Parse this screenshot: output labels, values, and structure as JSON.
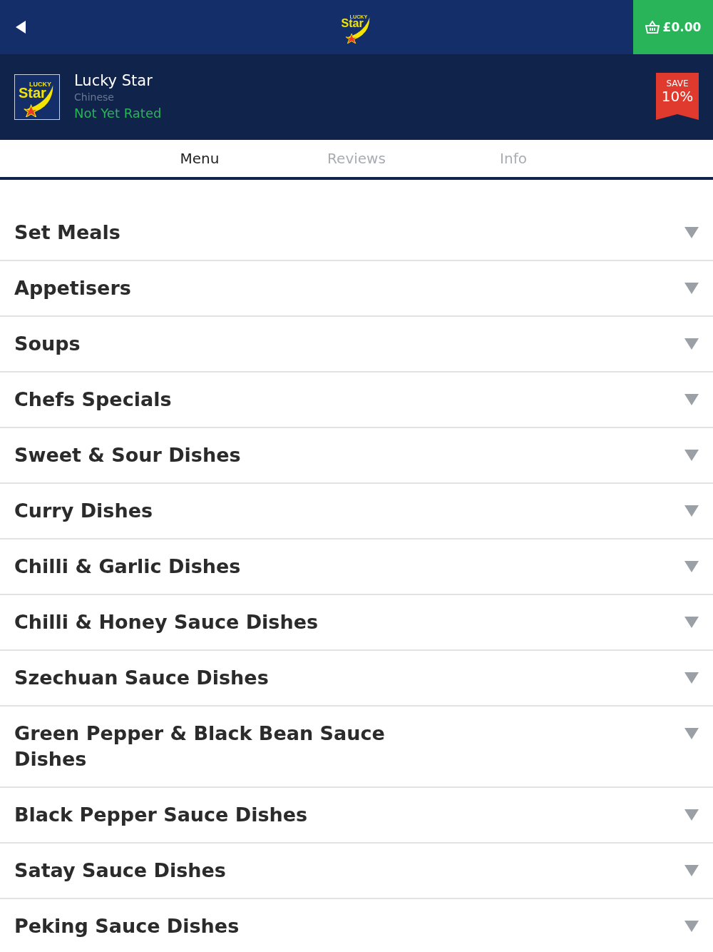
{
  "top_bar": {
    "logo": {
      "small": "LUCKY",
      "big": "Star"
    },
    "cart_total": "£0.00"
  },
  "restaurant": {
    "logo": {
      "small": "LUCKY",
      "big": "Star"
    },
    "name": "Lucky Star",
    "cuisine": "Chinese",
    "rating": "Not Yet Rated",
    "offer": {
      "label": "SAVE",
      "value": "10%"
    }
  },
  "tabs": [
    {
      "label": "Menu",
      "selected": true
    },
    {
      "label": "Reviews",
      "selected": false
    },
    {
      "label": "Info",
      "selected": false
    }
  ],
  "categories": [
    {
      "name": "Set Meals",
      "expanded": false
    },
    {
      "name": "Appetisers",
      "expanded": false
    },
    {
      "name": "Soups",
      "expanded": false
    },
    {
      "name": "Chefs Specials",
      "expanded": false
    },
    {
      "name": "Sweet & Sour Dishes",
      "expanded": false
    },
    {
      "name": "Curry Dishes",
      "expanded": false
    },
    {
      "name": "Chilli & Garlic Dishes",
      "expanded": false
    },
    {
      "name": "Chilli & Honey Sauce Dishes",
      "expanded": false
    },
    {
      "name": "Szechuan Sauce Dishes",
      "expanded": false
    },
    {
      "name": "Green Pepper & Black Bean Sauce Dishes",
      "expanded": false
    },
    {
      "name": "Black Pepper Sauce Dishes",
      "expanded": false
    },
    {
      "name": "Satay Sauce Dishes",
      "expanded": false
    },
    {
      "name": "Peking Sauce Dishes",
      "expanded": false
    }
  ]
}
